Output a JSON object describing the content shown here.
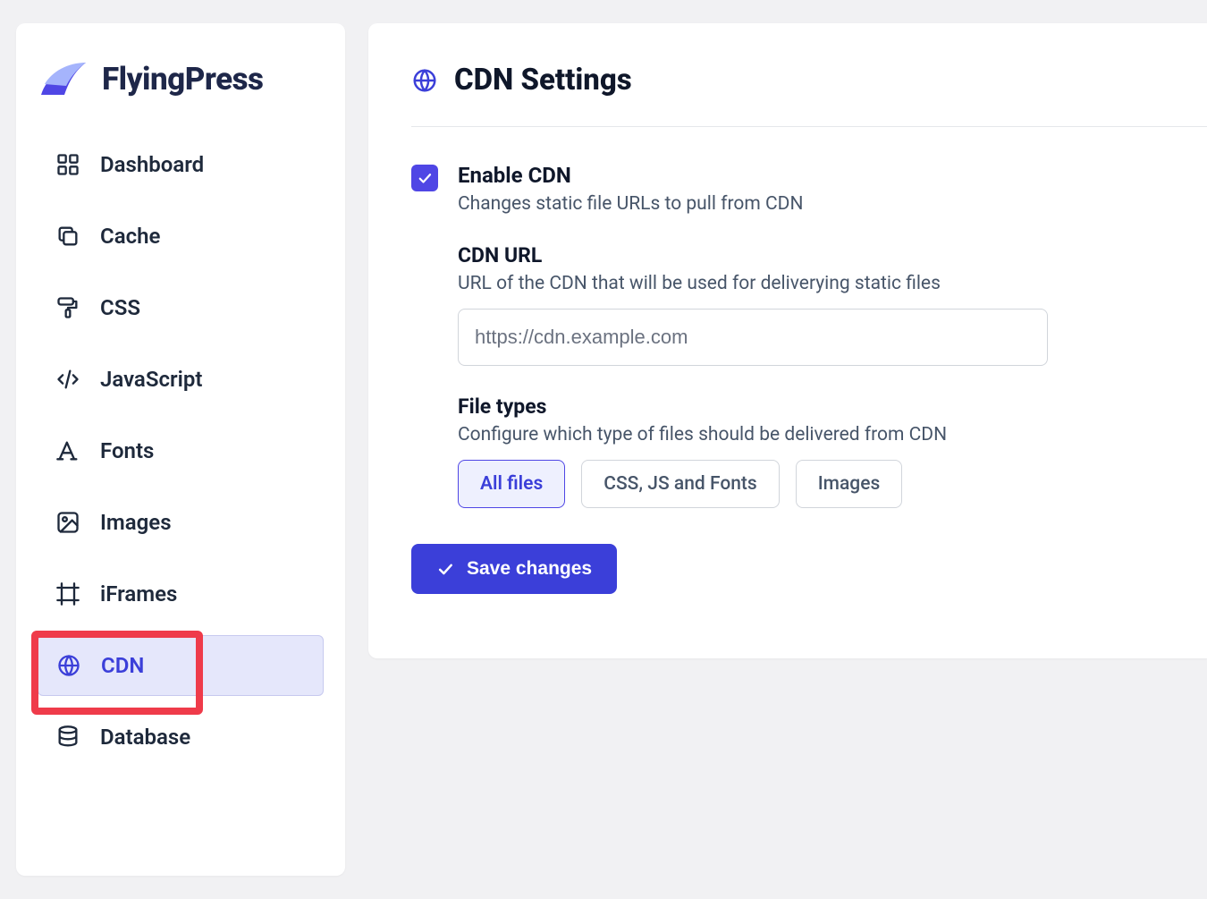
{
  "brand": {
    "name": "FlyingPress"
  },
  "sidebar": {
    "items": [
      {
        "label": "Dashboard"
      },
      {
        "label": "Cache"
      },
      {
        "label": "CSS"
      },
      {
        "label": "JavaScript"
      },
      {
        "label": "Fonts"
      },
      {
        "label": "Images"
      },
      {
        "label": "iFrames"
      },
      {
        "label": "CDN"
      },
      {
        "label": "Database"
      }
    ],
    "active_index": 7,
    "highlighted_index": 7
  },
  "page": {
    "title": "CDN Settings",
    "enable_cdn": {
      "label": "Enable CDN",
      "description": "Changes static file URLs to pull from CDN",
      "checked": true
    },
    "cdn_url": {
      "label": "CDN URL",
      "description": "URL of the CDN that will be used for deliverying static files",
      "placeholder": "https://cdn.example.com",
      "value": ""
    },
    "file_types": {
      "label": "File types",
      "description": "Configure which type of files should be delivered from CDN",
      "options": [
        "All files",
        "CSS, JS and Fonts",
        "Images"
      ],
      "selected_index": 0
    },
    "save_label": "Save changes"
  }
}
